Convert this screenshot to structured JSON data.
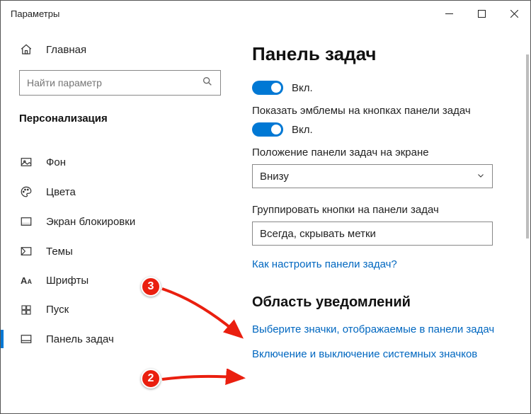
{
  "window": {
    "title": "Параметры"
  },
  "sidebar": {
    "home": "Главная",
    "search_placeholder": "Найти параметр",
    "section": "Персонализация",
    "items": [
      {
        "label": "Фон"
      },
      {
        "label": "Цвета"
      },
      {
        "label": "Экран блокировки"
      },
      {
        "label": "Темы"
      },
      {
        "label": "Шрифты"
      },
      {
        "label": "Пуск"
      },
      {
        "label": "Панель задач"
      }
    ]
  },
  "main": {
    "heading": "Панель задач",
    "toggle1_label": "Вкл.",
    "caption_badges": "Показать эмблемы на кнопках панели задач",
    "toggle2_label": "Вкл.",
    "caption_position": "Положение панели задач на экране",
    "position_value": "Внизу",
    "caption_group": "Группировать кнопки на панели задач",
    "group_value": "Всегда, скрывать метки",
    "help_link": "Как настроить панели задач?",
    "section_notif": "Область уведомлений",
    "link_icons": "Выберите значки, отображаемые в панели задач",
    "link_system_icons": "Включение и выключение системных значков"
  },
  "annotations": {
    "badge_2": "2",
    "badge_3": "3"
  }
}
